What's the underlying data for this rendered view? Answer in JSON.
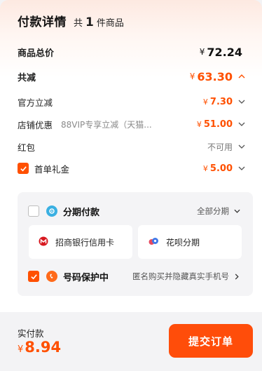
{
  "header": {
    "title": "付款详情",
    "count_prefix": "共",
    "count": "1",
    "count_suffix": "件商品"
  },
  "rows": {
    "total": {
      "label": "商品总价",
      "currency": "¥",
      "amount": "72.24"
    },
    "reduce": {
      "label": "共减",
      "currency": "¥",
      "amount": "63.30"
    },
    "official": {
      "label": "官方立减",
      "currency": "¥",
      "amount": "7.30"
    },
    "store": {
      "label": "店铺优惠",
      "sub": "88VIP专享立减（天猫...",
      "currency": "¥",
      "amount": "51.00"
    },
    "redpacket": {
      "label": "红包",
      "value": "不可用"
    },
    "first_order": {
      "label": "首单礼金",
      "currency": "¥",
      "amount": "5.00",
      "checked": true
    }
  },
  "installment": {
    "label": "分期付款",
    "right_label": "全部分期",
    "checked": false,
    "options": [
      {
        "label": "招商银行信用卡",
        "icon": "cmb-bank-icon"
      },
      {
        "label": "花呗分期",
        "icon": "huabei-icon"
      }
    ]
  },
  "privacy": {
    "label": "号码保护中",
    "right_label": "匿名购买并隐藏真实手机号",
    "checked": true
  },
  "footer": {
    "pay_label": "实付款",
    "currency": "¥",
    "amount": "8.94",
    "submit_label": "提交订单"
  },
  "colors": {
    "accent": "#ff5000",
    "panel": "#f4f4f6",
    "installment_icon": "#3ab0e2",
    "privacy_icon": "#ff6a1a"
  }
}
